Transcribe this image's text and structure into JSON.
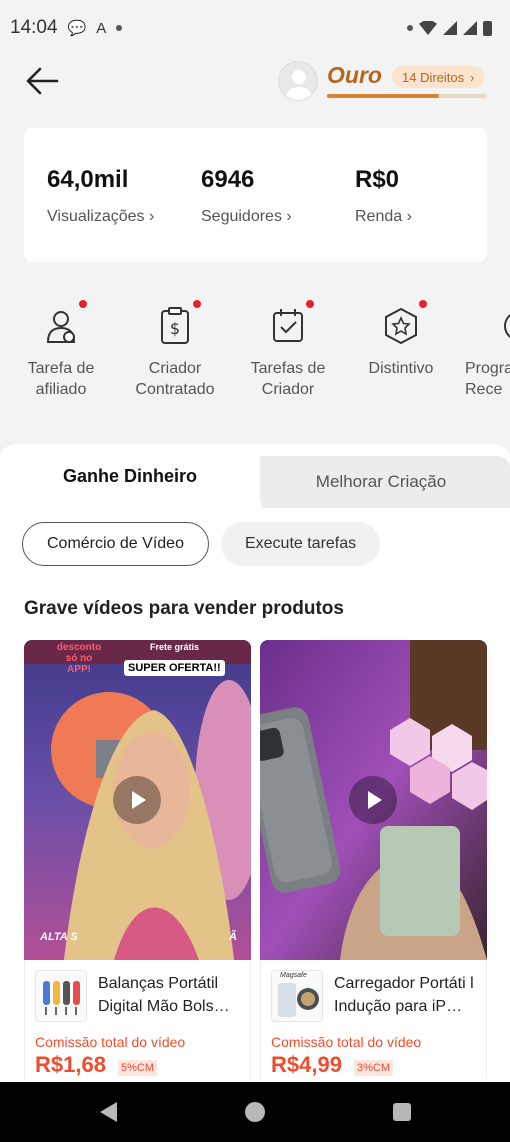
{
  "status_bar": {
    "time": "14:04"
  },
  "header": {
    "tier": "Ouro",
    "rights_label": "14 Direitos",
    "tier_progress": 0.7
  },
  "stats": [
    {
      "value": "64,0mil",
      "label": "Visualizações"
    },
    {
      "value": "6946",
      "label": "Seguidores"
    },
    {
      "value": "R$0",
      "label": "Renda"
    }
  ],
  "tools": [
    {
      "label": "Tarefa de afiliado",
      "icon": "affiliate-user-icon"
    },
    {
      "label": "Criador Contratado",
      "icon": "contract-dollar-icon"
    },
    {
      "label": "Tarefas de Criador",
      "icon": "calendar-check-icon"
    },
    {
      "label": "Distintivo",
      "icon": "badge-star-icon"
    },
    {
      "label": "Progra Rece",
      "icon": "program-icon"
    }
  ],
  "tabs": {
    "active": "Ganhe Dinheiro",
    "inactive": "Melhorar Criação"
  },
  "chips": [
    "Comércio de Vídeo",
    "Execute tarefas"
  ],
  "section_title": "Grave vídeos para vender produtos",
  "products": [
    {
      "name": "Balanças Portátil Digital Mão Bols…",
      "commission_label": "Comissão total do vídeo",
      "price": "R$1,68",
      "percent": "5%CM",
      "overlay_top": "desconto só no APP!",
      "overlay_free": "Frete grátis",
      "overlay_sale": "SUPER OFERTA!!",
      "overlay_bottom": "ALTA S",
      "overlay_bottom_right": "Ã"
    },
    {
      "name": "Carregador Portáti l Indução para iP…",
      "commission_label": "Comissão total do vídeo",
      "price": "R$4,99",
      "percent": "3%CM",
      "thumb_label": "Magsafe"
    }
  ]
}
